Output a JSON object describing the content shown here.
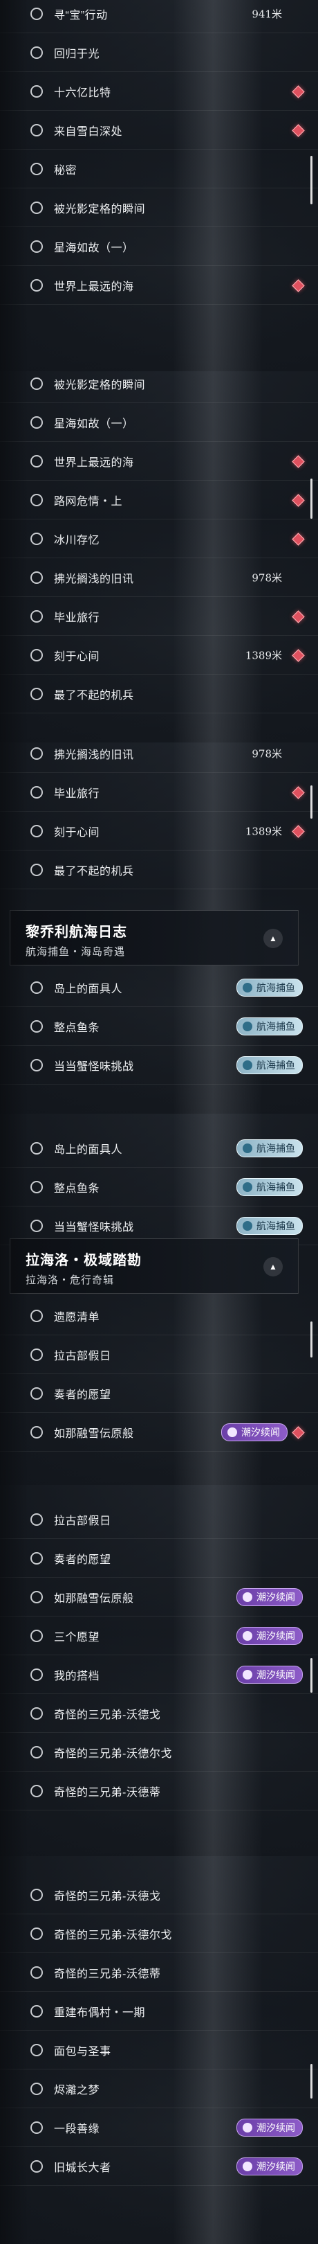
{
  "accent": {
    "diamond": "#e0515f",
    "teal_tag": "#a9cbd9",
    "purple_tag": "#7b4bb8"
  },
  "icons": {
    "row_marker": "circle-icon",
    "quest_marker": "diamond-icon",
    "collapse": "chevron-up-icon"
  },
  "screens": [
    {
      "rows": [
        {
          "label": "寻“宝”行动",
          "distance": "941米"
        },
        {
          "label": "回归于光"
        },
        {
          "label": "十六亿比特",
          "marker": true
        },
        {
          "label": "来自雪白深处",
          "marker": true
        },
        {
          "label": "秘密"
        },
        {
          "label": "被光影定格的瞬间"
        },
        {
          "label": "星海如故（一）"
        },
        {
          "label": "世界上最远的海",
          "marker": true
        }
      ]
    },
    {
      "rows": [
        {
          "label": "被光影定格的瞬间"
        },
        {
          "label": "星海如故（一）"
        },
        {
          "label": "世界上最远的海",
          "marker": true
        },
        {
          "label": "路网危情・上",
          "marker": true
        },
        {
          "label": "冰川存忆",
          "marker": true
        },
        {
          "label": "拂光搁浅的旧讯",
          "distance": "978米"
        },
        {
          "label": "毕业旅行",
          "marker": true
        },
        {
          "label": "刻于心间",
          "distance": "1389米",
          "marker": true
        },
        {
          "label": "最了不起的机兵"
        }
      ]
    },
    {
      "rows": [
        {
          "label": "拂光搁浅的旧讯",
          "distance": "978米"
        },
        {
          "label": "毕业旅行",
          "marker": true
        },
        {
          "label": "刻于心间",
          "distance": "1389米",
          "marker": true
        },
        {
          "label": "最了不起的机兵"
        }
      ],
      "header": {
        "title": "黎乔利航海日志",
        "subtitle": "航海捕鱼・海岛奇遇"
      },
      "rows_after": [
        {
          "label": "岛上的面具人",
          "tag": "航海捕鱼"
        },
        {
          "label": "整点鱼条",
          "tag": "航海捕鱼"
        },
        {
          "label": "当当蟹怪味挑战",
          "tag": "航海捕鱼"
        }
      ]
    },
    {
      "rows": [
        {
          "label": "岛上的面具人",
          "tag": "航海捕鱼"
        },
        {
          "label": "整点鱼条",
          "tag": "航海捕鱼"
        },
        {
          "label": "当当蟹怪味挑战",
          "tag": "航海捕鱼"
        }
      ],
      "header": {
        "title": "拉海洛・极域踏勘",
        "subtitle": "拉海洛・危行奇辑"
      },
      "rows_after": [
        {
          "label": "遗愿清单"
        },
        {
          "label": "拉古部假日"
        },
        {
          "label": "奏者的愿望"
        },
        {
          "label": "如那融雪伝原般",
          "tag": "潮汐续闻",
          "marker": true
        }
      ]
    },
    {
      "rows": [
        {
          "label": "拉古部假日"
        },
        {
          "label": "奏者的愿望"
        },
        {
          "label": "如那融雪伝原般",
          "tag": "潮汐续闻"
        },
        {
          "label": "三个愿望",
          "tag": "潮汐续闻"
        },
        {
          "label": "我的搭档",
          "tag": "潮汐续闻"
        },
        {
          "label": "奇怪的三兄弟-沃德戈"
        },
        {
          "label": "奇怪的三兄弟-沃德尔戈"
        },
        {
          "label": "奇怪的三兄弟-沃德蒂"
        }
      ]
    },
    {
      "rows": [
        {
          "label": "奇怪的三兄弟-沃德戈"
        },
        {
          "label": "奇怪的三兄弟-沃德尔戈"
        },
        {
          "label": "奇怪的三兄弟-沃德蒂"
        },
        {
          "label": "重建布偶村・一期"
        },
        {
          "label": "面包与圣事"
        },
        {
          "label": "烬灕之梦"
        },
        {
          "label": "一段善缘",
          "tag": "潮汐续闻"
        },
        {
          "label": "旧城长大者",
          "tag": "潮汐续闻"
        }
      ]
    }
  ]
}
